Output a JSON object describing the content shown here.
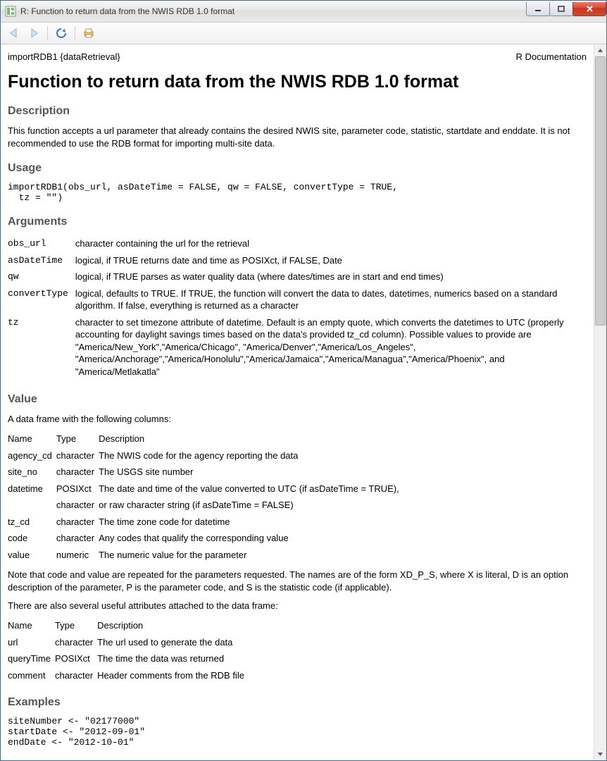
{
  "window": {
    "title": "R: Function to return data from the NWIS RDB 1.0 format"
  },
  "header": {
    "left": "importRDB1 {dataRetrieval}",
    "right": "R Documentation"
  },
  "page_title": "Function to return data from the NWIS RDB 1.0 format",
  "sections": {
    "description_h": "Description",
    "description_p": "This function accepts a url parameter that already contains the desired NWIS site, parameter code, statistic, startdate and enddate. It is not recommended to use the RDB format for importing multi-site data.",
    "usage_h": "Usage",
    "usage_code": "importRDB1(obs_url, asDateTime = FALSE, qw = FALSE, convertType = TRUE,\n  tz = \"\")",
    "arguments_h": "Arguments",
    "value_h": "Value",
    "value_intro": "A data frame with the following columns:",
    "value_note1": "Note that code and value are repeated for the parameters requested. The names are of the form XD_P_S, where X is literal, D is an option description of the parameter, P is the parameter code, and S is the statistic code (if applicable).",
    "value_note2": "There are also several useful attributes attached to the data frame:",
    "examples_h": "Examples",
    "examples_code": "siteNumber <- \"02177000\"\nstartDate <- \"2012-09-01\"\nendDate <- \"2012-10-01\""
  },
  "arguments": [
    {
      "name": "obs_url",
      "desc": "character containing the url for the retrieval"
    },
    {
      "name": "asDateTime",
      "desc": "logical, if TRUE returns date and time as POSIXct, if FALSE, Date"
    },
    {
      "name": "qw",
      "desc": "logical, if TRUE parses as water quality data (where dates/times are in start and end times)"
    },
    {
      "name": "convertType",
      "desc": "logical, defaults to TRUE. If TRUE, the function will convert the data to dates, datetimes, numerics based on a standard algorithm. If false, everything is returned as a character"
    },
    {
      "name": "tz",
      "desc": "character to set timezone attribute of datetime. Default is an empty quote, which converts the datetimes to UTC (properly accounting for daylight savings times based on the data's provided tz_cd column). Possible values to provide are \"America/New_York\",\"America/Chicago\", \"America/Denver\",\"America/Los_Angeles\", \"America/Anchorage\",\"America/Honolulu\",\"America/Jamaica\",\"America/Managua\",\"America/Phoenix\", and \"America/Metlakatla\""
    }
  ],
  "value_cols": {
    "c1": "Name",
    "c2": "Type",
    "c3": "Description"
  },
  "value_rows": [
    {
      "name": "agency_cd",
      "type": "character",
      "desc": "The NWIS code for the agency reporting the data"
    },
    {
      "name": "site_no",
      "type": "character",
      "desc": "The USGS site number"
    },
    {
      "name": "datetime",
      "type": "POSIXct",
      "desc": "The date and time of the value converted to UTC (if asDateTime = TRUE),"
    },
    {
      "name": "",
      "type": "character",
      "desc": "or raw character string (if asDateTime = FALSE)"
    },
    {
      "name": "tz_cd",
      "type": "character",
      "desc": "The time zone code for datetime"
    },
    {
      "name": "code",
      "type": "character",
      "desc": "Any codes that qualify the corresponding value"
    },
    {
      "name": "value",
      "type": "numeric",
      "desc": "The numeric value for the parameter"
    }
  ],
  "attr_rows": [
    {
      "name": "url",
      "type": "character",
      "desc": "The url used to generate the data"
    },
    {
      "name": "queryTime",
      "type": "POSIXct",
      "desc": "The time the data was returned"
    },
    {
      "name": "comment",
      "type": "character",
      "desc": "Header comments from the RDB file"
    }
  ]
}
